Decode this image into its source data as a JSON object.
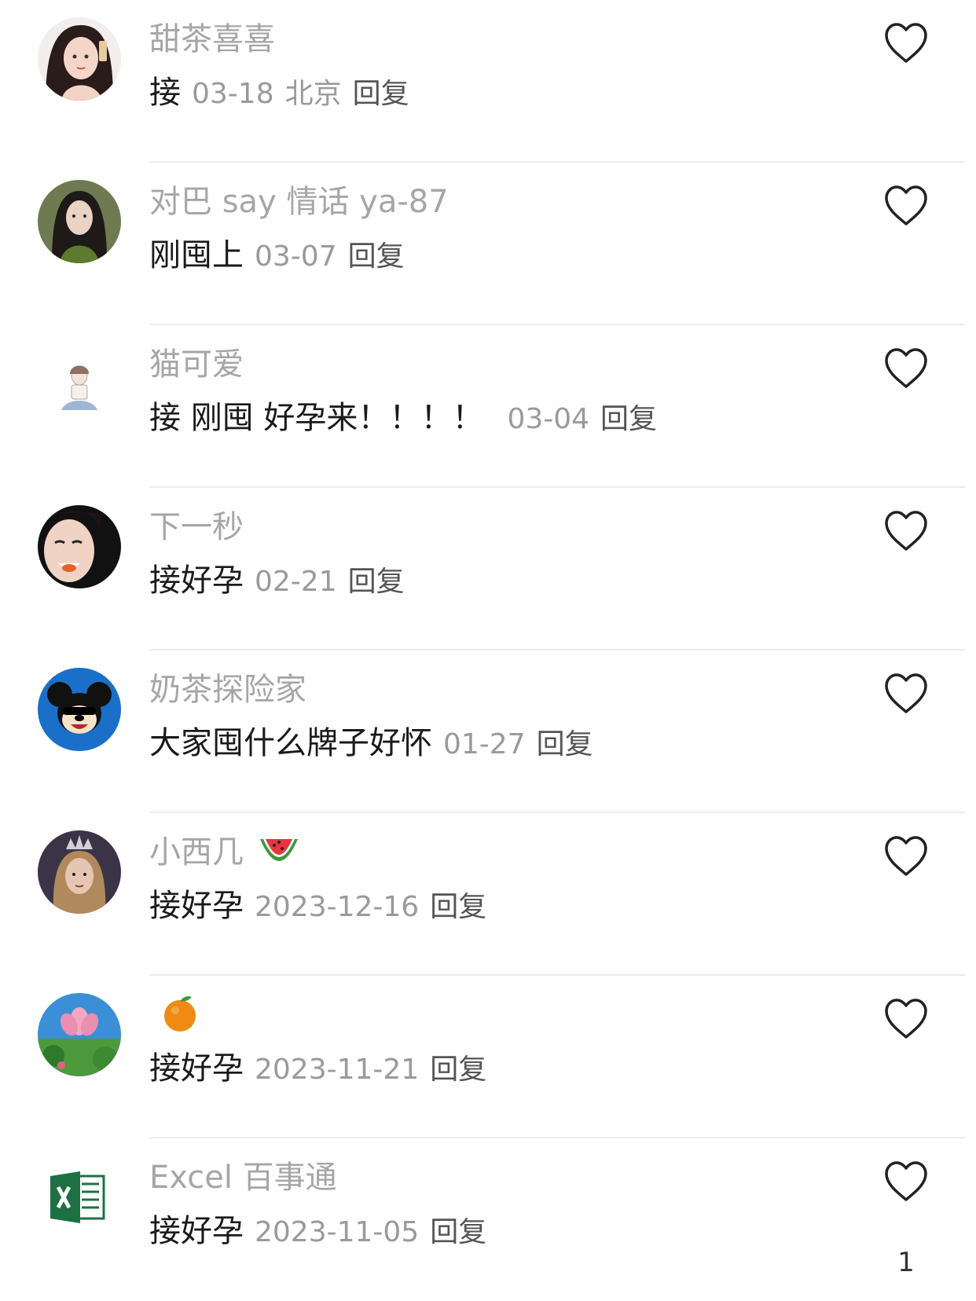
{
  "comments": [
    {
      "name": "甜茶喜喜",
      "text": "接",
      "date": "03-18",
      "location": "北京",
      "reply": "回复",
      "avatar_icon": "avatar-girl-icon"
    },
    {
      "name": "对巴 say 情话 ya-87",
      "text": "刚囤上",
      "date": "03-07",
      "reply": "回复",
      "avatar_icon": "avatar-girl-green-icon"
    },
    {
      "name": "猫可爱",
      "text": "接 刚囤 好孕来！！！！",
      "date": "03-04",
      "reply": "回复",
      "avatar_icon": "avatar-sketch-icon"
    },
    {
      "name": "下一秒",
      "text": "接好孕",
      "date": "02-21",
      "reply": "回复",
      "avatar_icon": "avatar-smile-icon"
    },
    {
      "name": "奶茶探险家",
      "text": "大家囤什么牌子好怀",
      "date": "01-27",
      "reply": "回复",
      "avatar_icon": "mickey-avatar-icon"
    },
    {
      "name": "小西几",
      "name_emoji": "watermelon-icon",
      "text": "接好孕",
      "date": "2023-12-16",
      "reply": "回复",
      "avatar_icon": "avatar-crown-icon"
    },
    {
      "name": "",
      "name_emoji": "orange-icon",
      "text": "接好孕",
      "date": "2023-11-21",
      "reply": "回复",
      "avatar_icon": "lotus-avatar-icon"
    },
    {
      "name": "Excel 百事通",
      "text": "接好孕",
      "date": "2023-11-05",
      "reply": "回复",
      "avatar_icon": "excel-avatar-icon",
      "like_count": "1"
    }
  ],
  "colors": {
    "name": "#a6a6a6",
    "text": "#1a1a1a",
    "date": "#9a9a9a",
    "divider": "#ececec"
  }
}
